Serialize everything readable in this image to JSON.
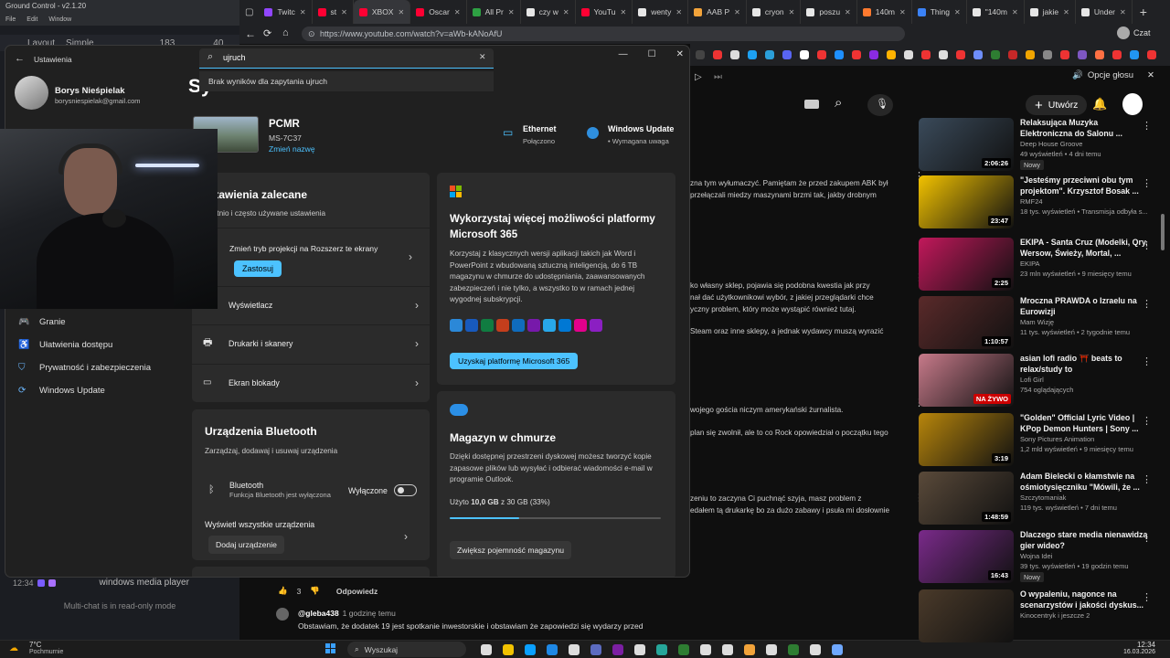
{
  "ground_control": {
    "title": "Ground Control - v2.1.20",
    "menu": [
      "File",
      "Edit",
      "Window"
    ],
    "layout_label": "Layout",
    "layout_value": "Simple",
    "count_a": "183",
    "count_b": "40",
    "chat_time": "12:34",
    "chat_text": "windows media player",
    "readonly": "Multi-chat is in read-only mode"
  },
  "browser": {
    "tabs": [
      {
        "label": "Twitc",
        "color": "#9146ff"
      },
      {
        "label": "st",
        "color": "#ff0033"
      },
      {
        "label": "XBOX",
        "color": "#ff0033",
        "active": true
      },
      {
        "label": "Oscar",
        "color": "#ff0033"
      },
      {
        "label": "All Pr",
        "color": "#2ea043"
      },
      {
        "label": "czy w",
        "color": "#e6e6e6"
      },
      {
        "label": "YouTu",
        "color": "#ff0033"
      },
      {
        "label": "wenty",
        "color": "#e6e6e6"
      },
      {
        "label": "AAB P",
        "color": "#f2a33a"
      },
      {
        "label": "cryon",
        "color": "#e6e6e6"
      },
      {
        "label": "poszu",
        "color": "#e6e6e6"
      },
      {
        "label": "140m",
        "color": "#ff7a2f"
      },
      {
        "label": "Thing",
        "color": "#3b82f6"
      },
      {
        "label": "\"140m",
        "color": "#e6e6e6"
      },
      {
        "label": "jakie",
        "color": "#e6e6e6"
      },
      {
        "label": "Under",
        "color": "#e6e6e6"
      }
    ],
    "url": "https://www.youtube.com/watch?v=aWb-kANoAfU",
    "copilot_label": "Czat",
    "voice_label": "Opcje głosu"
  },
  "settings": {
    "search_value": "ujruch",
    "search_result": "Brak wyników dla zapytania ujruch",
    "window_title": "Ustawienia",
    "user_name": "Borys Nieśpielak",
    "user_email": "borysniespielak@gmail.com",
    "page_title_partial": "Sy",
    "device_name": "PCMR",
    "device_model": "MS-7C37",
    "rename": "Zmień nazwę",
    "ethernet_title": "Ethernet",
    "ethernet_status": "Połączono",
    "wu_title": "Windows Update",
    "wu_status": "Wymagana uwaga",
    "sidebar": [
      {
        "label": "Granie",
        "icon": "gamepad-icon"
      },
      {
        "label": "Ułatwienia dostępu",
        "icon": "accessibility-icon"
      },
      {
        "label": "Prywatność i zabezpieczenia",
        "icon": "shield-icon"
      },
      {
        "label": "Windows Update",
        "icon": "update-icon"
      }
    ],
    "recommended_title": "Ustawienia zalecane",
    "recommended_subtitle": "Ostatnio i często używane ustawienia",
    "recommended_items": [
      {
        "label": "Zmień tryb projekcji na Rozszerz te ekrany",
        "button": "Zastosuj"
      },
      {
        "label": "Wyświetlacz"
      },
      {
        "label": "Drukarki i skanery"
      },
      {
        "label": "Ekran blokady"
      }
    ],
    "bt_title": "Urządzenia Bluetooth",
    "bt_subtitle": "Zarządzaj, dodawaj i usuwaj urządzenia",
    "bt_name": "Bluetooth",
    "bt_desc": "Funkcja Bluetooth jest wyłączona",
    "bt_state": "Wyłączone",
    "bt_show_all": "Wyświetl wszystkie urządzenia",
    "bt_add": "Dodaj urządzenie",
    "m365_title": "Wykorzystaj więcej możliwości platformy Microsoft 365",
    "m365_body": "Korzystaj z klasycznych wersji aplikacji takich jak Word i PowerPoint z wbudowaną sztuczną inteligencją, do 6 TB magazynu w chmurze do udostępniania, zaawansowanych zabezpieczeń i nie tylko, a wszystko to w ramach jednej wygodnej subskrypcji.",
    "m365_button": "Uzyskaj platformę Microsoft 365",
    "cloud_title": "Magazyn w chmurze",
    "cloud_body": "Dzięki dostępnej przestrzeni dyskowej możesz tworzyć kopie zapasowe plików lub wysyłać i odbierać wiadomości e-mail w programie Outlook.",
    "cloud_used_prefix": "Użyto ",
    "cloud_used_value": "10,0 GB",
    "cloud_used_suffix": " z 30 GB (33%)",
    "cloud_used_fraction": 0.33,
    "cloud_button": "Zwiększ pojemność magazynu"
  },
  "youtube": {
    "create_label": "Utwórz",
    "comment_fragments": [
      "zna tym wyłumaczyć. Pamiętam że przed zakupem ABK był",
      "przełączali miedzy maszynami brzmi tak, jakby drobnym",
      "ko własny sklep, pojawia się podobna kwestia jak przy",
      "nał dać użytkownikowi wybór, z jakiej przeglądarki chce",
      "yczny problem, który może wystąpić również tutaj.",
      "Steam oraz inne sklepy, a jednak wydawcy muszą wyrazić",
      "wojego gościa niczym amerykański żurnalista.",
      "plan się zwolnił, ale to co Rock opowiedział o początku tego",
      "zeniu to zaczyna Ci puchnąć szyja, masz problem z",
      "edałem tą drukarkę bo za dużo zabawy i psuła mi dosłownie"
    ],
    "reply_likes": "3",
    "reply_label": "Odpowiedz",
    "comment_author": "@gleba438",
    "comment_time": "1 godzinę temu",
    "comment_text": "Obstawiam, że dodatek 19 jest spotkanie inwestorskie i obstawiam że zapowiedzi się wydarzy przed",
    "suggestions": [
      {
        "title": "Relaksująca Muzyka Elektroniczna do Salonu ...",
        "channel": "Deep House Groove",
        "meta": "49 wyświetleń • 4 dni temu",
        "badge": "Nowy",
        "duration": "2:06:26",
        "color": "#3a4a5a"
      },
      {
        "title": "\"Jesteśmy przeciwni obu tym projektom\". Krzysztof Bosak ...",
        "channel": "RMF24",
        "meta": "18 tys. wyświetleń • Transmisja odbyła s...",
        "badge": "",
        "duration": "23:47",
        "color": "#f2c200"
      },
      {
        "title": "EKIPA - Santa Cruz (Modelki, Qry, Wersow, Świeży, Mortal, ...",
        "channel": "EKIPA",
        "meta": "23 mln wyświetleń • 9 miesięcy temu",
        "badge": "",
        "duration": "2:25",
        "color": "#c2185b"
      },
      {
        "title": "Mroczna PRAWDA o Izraelu na Eurowizji",
        "channel": "Mam Wizję",
        "meta": "11 tys. wyświetleń • 2 tygodnie temu",
        "badge": "",
        "duration": "1:10:57",
        "color": "#5a2a2a"
      },
      {
        "title": "asian lofi radio ⛩️ beats to relax/study to",
        "channel": "Lofi Girl",
        "meta": "754 oglądających",
        "badge": "",
        "duration": "NA ŻYWO",
        "color": "#c77a8a"
      },
      {
        "title": "\"Golden\" Official Lyric Video | KPop Demon Hunters | Sony ...",
        "channel": "Sony Pictures Animation",
        "meta": "1,2 mld wyświetleń • 9 miesięcy temu",
        "badge": "",
        "duration": "3:19",
        "color": "#b8860b"
      },
      {
        "title": "Adam Bielecki o kłamstwie na ośmiotysięczniku \"Mówili, że ...",
        "channel": "Szczytomaniak",
        "meta": "119 tys. wyświetleń • 7 dni temu",
        "badge": "",
        "duration": "1:48:59",
        "color": "#5a4a3a"
      },
      {
        "title": "Dlaczego stare media nienawidzą gier wideo?",
        "channel": "Wojna Idei",
        "meta": "39 tys. wyświetleń • 19 godzin temu",
        "badge": "Nowy",
        "duration": "16:43",
        "color": "#7a2a8a"
      },
      {
        "title": "O wypaleniu, nagonce na scenarzystów i jakości dyskus...",
        "channel": "Kinocentryk i jeszcze 2",
        "meta": "",
        "badge": "",
        "duration": "",
        "color": "#4a3a2a"
      }
    ]
  },
  "taskbar": {
    "weather_temp": "7°C",
    "weather_desc": "Pochmurnie",
    "search_label": "Wyszukaj",
    "time": "12:34",
    "date": "16.03.2026"
  }
}
